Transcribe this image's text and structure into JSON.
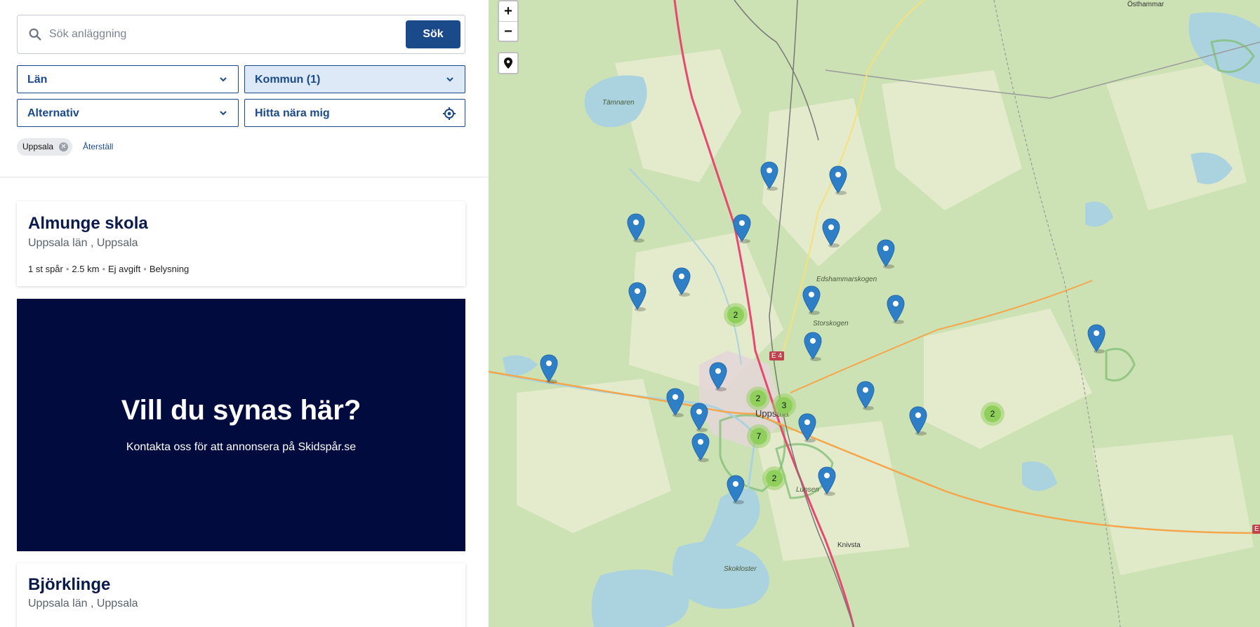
{
  "search": {
    "placeholder": "Sök anläggning",
    "button_label": "Sök"
  },
  "filters": {
    "lan": "Län",
    "kommun": "Kommun (1)",
    "alternativ": "Alternativ",
    "near_me": "Hitta nära mig"
  },
  "active_tags": {
    "tag_label": "Uppsala",
    "reset_label": "Återställ"
  },
  "results": [
    {
      "name": "Almunge skola",
      "location": "Uppsala län , Uppsala",
      "tracks": "1 st spår",
      "length": "2.5 km",
      "fee": "Ej avgift",
      "lighting": "Belysning"
    },
    {
      "name": "Björklinge",
      "location": "Uppsala län , Uppsala"
    }
  ],
  "ad": {
    "heading": "Vill du synas här?",
    "text": "Kontakta oss för att annonsera på Skidspår.se"
  },
  "map": {
    "zoom_in": "+",
    "zoom_out": "−",
    "labels": {
      "tamnaren": "Tämnaren",
      "osthammar": "Östhammar",
      "edshammarskogen": "Edshammarskogen",
      "storskogen": "Storskogen",
      "uppsala": "Uppsala",
      "lunsen": "Lunsen",
      "knivsta": "Knivsta",
      "skokloster": "Skokloster",
      "e4": "E 4",
      "e_right": "E"
    },
    "clusters": [
      {
        "id": "c1",
        "count": "2"
      },
      {
        "id": "c2",
        "count": "2"
      },
      {
        "id": "c3",
        "count": "3"
      },
      {
        "id": "c4",
        "count": "2"
      },
      {
        "id": "c5",
        "count": "7"
      },
      {
        "id": "c6",
        "count": "2"
      }
    ],
    "pin_color": "#2f7fc7",
    "cluster_color": "#8fd05c"
  }
}
